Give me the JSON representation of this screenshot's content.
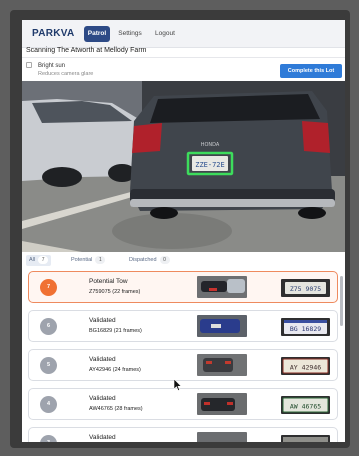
{
  "nav": {
    "logo": "PARKVA",
    "tabs": [
      {
        "label": "Patrol",
        "active": true
      },
      {
        "label": "Settings",
        "active": false
      },
      {
        "label": "Logout",
        "active": false
      }
    ]
  },
  "page": {
    "title": "Scanning The Atworth at Mellody Farm"
  },
  "option": {
    "label": "Bright sun",
    "sub": "Reduces camera glare",
    "checked": false
  },
  "action": {
    "complete_label": "Complete this Lot"
  },
  "camera": {
    "plate_text": "ZZE-72E",
    "brand_text": "HONDA"
  },
  "filters": [
    {
      "label": "All",
      "count": "7",
      "active": true
    },
    {
      "label": "Potential",
      "count": "1",
      "active": false
    },
    {
      "label": "Dispatched",
      "count": "0",
      "active": false
    }
  ],
  "items": [
    {
      "number": "7",
      "status": "Potential Tow",
      "plate": "Z759075 (22 frames)",
      "alert": true,
      "crop_text": "Z75 9075"
    },
    {
      "number": "6",
      "status": "Validated",
      "plate": "BG16829 (21 frames)",
      "alert": false,
      "crop_text": "BG 16829"
    },
    {
      "number": "5",
      "status": "Validated",
      "plate": "AY42946 (24 frames)",
      "alert": false,
      "crop_text": "AY 42946"
    },
    {
      "number": "4",
      "status": "Validated",
      "plate": "AW46765 (28 frames)",
      "alert": false,
      "crop_text": "AW 46765"
    },
    {
      "number": "3",
      "status": "Validated",
      "plate": "",
      "alert": false,
      "crop_text": ""
    }
  ],
  "colors": {
    "brand": "#1f3a6b",
    "primary": "#2f7bd8",
    "alert": "#f07133",
    "plate_box": "#3ddc5c"
  }
}
